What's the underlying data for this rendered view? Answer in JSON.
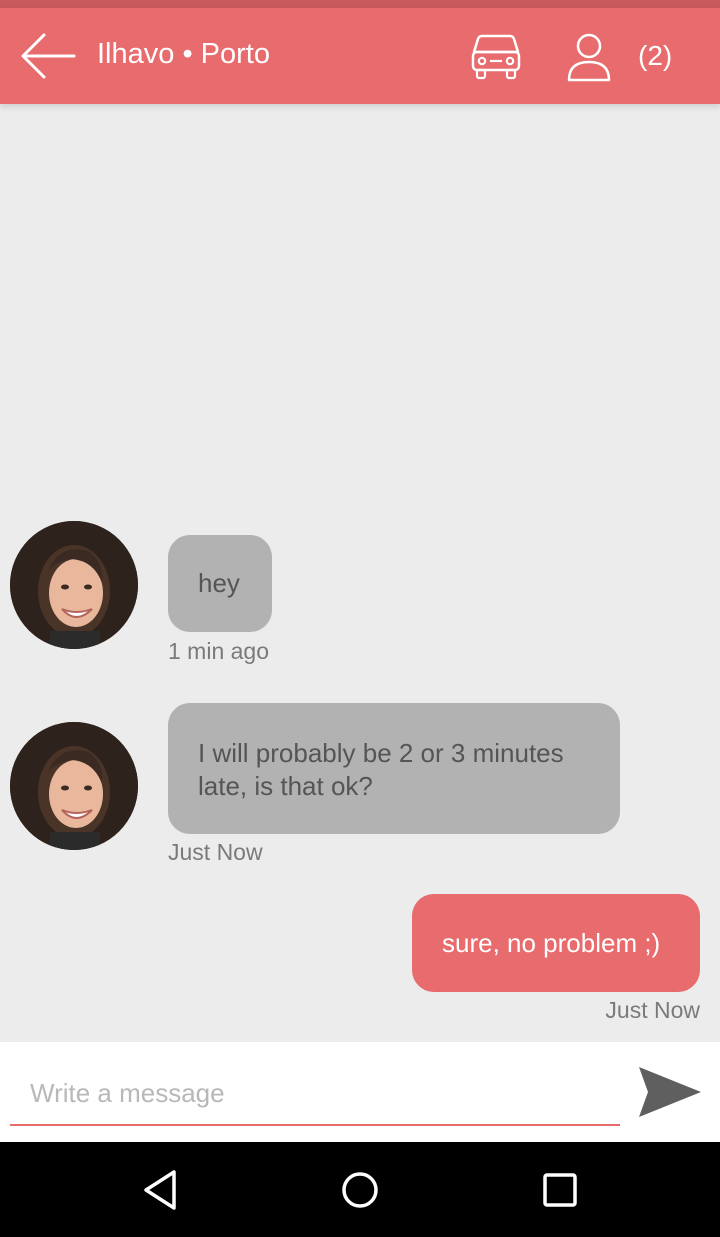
{
  "header": {
    "title": "Ilhavo • Porto",
    "passenger_count": "(2)"
  },
  "icons": {
    "back": "arrow-left-icon",
    "car": "car-icon",
    "person": "person-icon",
    "send": "send-icon",
    "nav_back": "triangle-back-icon",
    "nav_home": "circle-home-icon",
    "nav_recents": "square-recents-icon"
  },
  "colors": {
    "accent": "#e86b6d",
    "incoming_bubble": "#b3b2b3",
    "background": "#ececec"
  },
  "messages": [
    {
      "direction": "incoming",
      "text": "hey",
      "time": "1 min ago"
    },
    {
      "direction": "incoming",
      "text": "I will probably be 2 or 3 minutes late, is that ok?",
      "time": "Just Now"
    },
    {
      "direction": "outgoing",
      "text": "sure, no problem ;)",
      "time": "Just Now"
    }
  ],
  "composer": {
    "placeholder": "Write a message",
    "value": ""
  }
}
